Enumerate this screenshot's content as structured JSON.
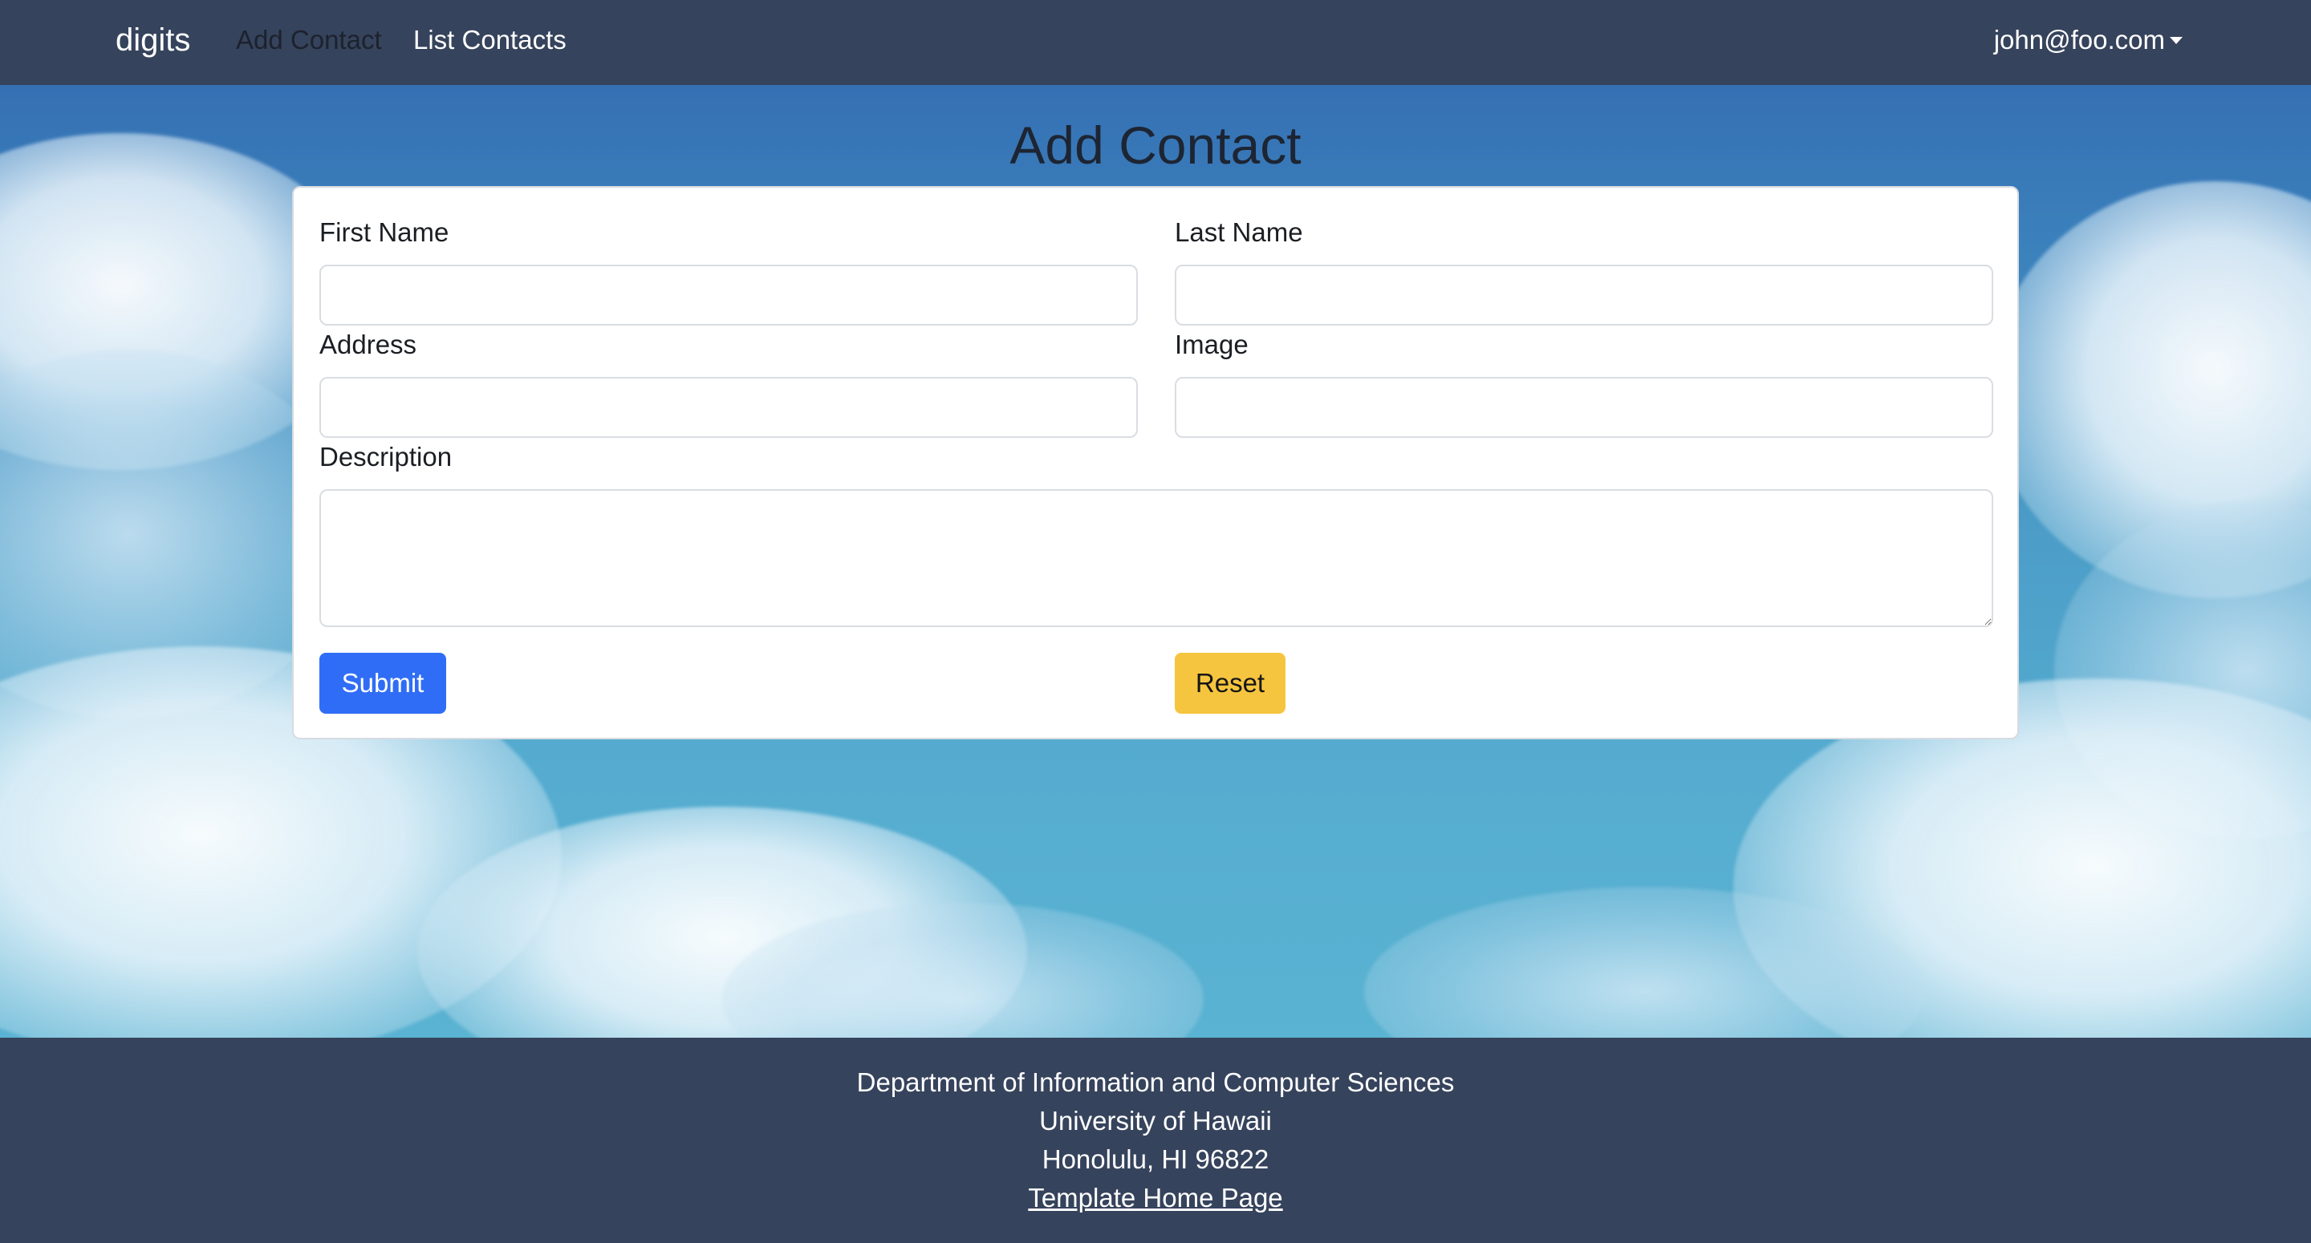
{
  "navbar": {
    "brand": "digits",
    "links": [
      {
        "label": "Add Contact",
        "active": true
      },
      {
        "label": "List Contacts",
        "active": false
      }
    ],
    "user": {
      "label": "john@foo.com"
    }
  },
  "page": {
    "title": "Add Contact"
  },
  "form": {
    "first_name": {
      "label": "First Name",
      "value": "",
      "placeholder": ""
    },
    "last_name": {
      "label": "Last Name",
      "value": "",
      "placeholder": ""
    },
    "address": {
      "label": "Address",
      "value": "",
      "placeholder": ""
    },
    "image": {
      "label": "Image",
      "value": "",
      "placeholder": ""
    },
    "description": {
      "label": "Description",
      "value": "",
      "placeholder": ""
    },
    "submit_label": "Submit",
    "reset_label": "Reset"
  },
  "footer": {
    "line1": "Department of Information and Computer Sciences",
    "line2": "University of Hawaii",
    "line3": "Honolulu, HI 96822",
    "link_label": "Template Home Page"
  },
  "colors": {
    "navbar_bg": "#36435c",
    "submit_bg": "#2f6df6",
    "reset_bg": "#f6c53f",
    "sky_top": "#3570b3",
    "sky_bottom": "#5ab3d2"
  }
}
